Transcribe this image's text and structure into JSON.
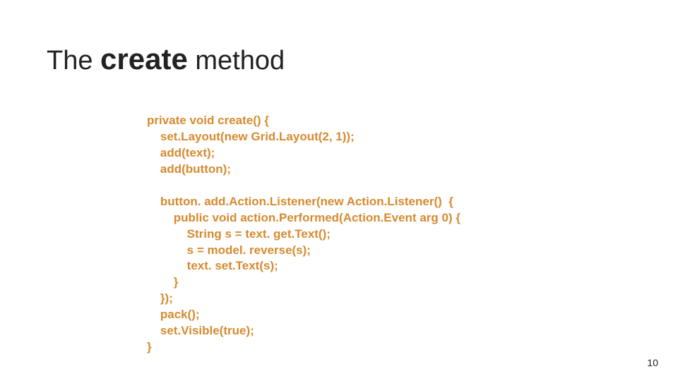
{
  "title": {
    "prefix": "The ",
    "emph": "create",
    "suffix": " method"
  },
  "code": "private void create() {\n    set.Layout(new Grid.Layout(2, 1));\n    add(text);\n    add(button);\n\n    button. add.Action.Listener(new Action.Listener()  {\n        public void action.Performed(Action.Event arg 0) {\n            String s = text. get.Text();\n            s = model. reverse(s);\n            text. set.Text(s);\n        }\n    });\n    pack();\n    set.Visible(true);\n}",
  "page_number": "10"
}
